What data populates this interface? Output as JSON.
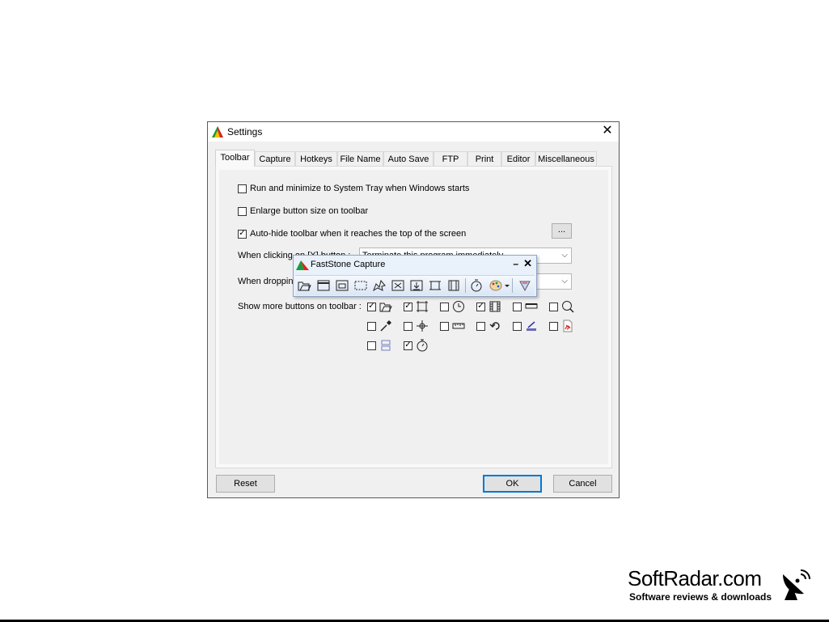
{
  "window": {
    "title": "Settings",
    "close_glyph": "✕"
  },
  "tabs": [
    "Toolbar",
    "Capture",
    "Hotkeys",
    "File Name",
    "Auto Save",
    "FTP",
    "Print",
    "Editor",
    "Miscellaneous"
  ],
  "options": {
    "run_minimize": {
      "label": "Run and minimize to System Tray when Windows starts",
      "checked": false
    },
    "enlarge_buttons": {
      "label": "Enlarge button size on toolbar",
      "checked": false
    },
    "auto_hide": {
      "label": "Auto-hide toolbar when it reaches the top of the screen",
      "checked": true
    },
    "more_button_label": "...",
    "x_button": {
      "label": "When clicking on [X] button :",
      "value": "Terminate this program immediately"
    },
    "dropping": {
      "label": "When dropping",
      "value": ""
    },
    "more_buttons_label": "Show more buttons on toolbar :"
  },
  "toolbar_options": [
    {
      "icon": "open-folder-icon",
      "checked": true
    },
    {
      "icon": "fixed-region-icon",
      "checked": true
    },
    {
      "icon": "clock-icon",
      "checked": false
    },
    {
      "icon": "film-icon",
      "checked": true
    },
    {
      "icon": "minus-bar-icon",
      "checked": false
    },
    {
      "icon": "magnifier-icon",
      "checked": false
    },
    {
      "icon": "color-picker-icon",
      "checked": false
    },
    {
      "icon": "crosshair-icon",
      "checked": false
    },
    {
      "icon": "ruler-icon",
      "checked": false
    },
    {
      "icon": "undo-arrow-icon",
      "checked": false
    },
    {
      "icon": "scanner-icon",
      "checked": false
    },
    {
      "icon": "pdf-icon",
      "checked": false
    },
    {
      "icon": "panels-icon",
      "checked": false
    },
    {
      "icon": "timer-icon",
      "checked": true
    }
  ],
  "buttons": {
    "reset": "Reset",
    "ok": "OK",
    "cancel": "Cancel"
  },
  "floating_toolbar": {
    "title": "FastStone Capture",
    "minimize_glyph": "▬",
    "close_glyph": "✕",
    "tools": [
      "open-folder-icon",
      "window-icon",
      "object-icon",
      "rectangle-icon",
      "freehand-icon",
      "fullscreen-icon",
      "scrolling-icon",
      "fixed-region-icon",
      "film-icon",
      "timer-icon",
      "palette-icon",
      "settings-icon"
    ]
  },
  "brand": {
    "name": "SoftRadar.com",
    "tagline": "Software reviews & downloads"
  },
  "colors": {
    "accent": "#0078d7",
    "toolbar_bg": "#e9f1fb",
    "pdf_red": "#d9261c",
    "app_green": "#1a9b3a"
  }
}
